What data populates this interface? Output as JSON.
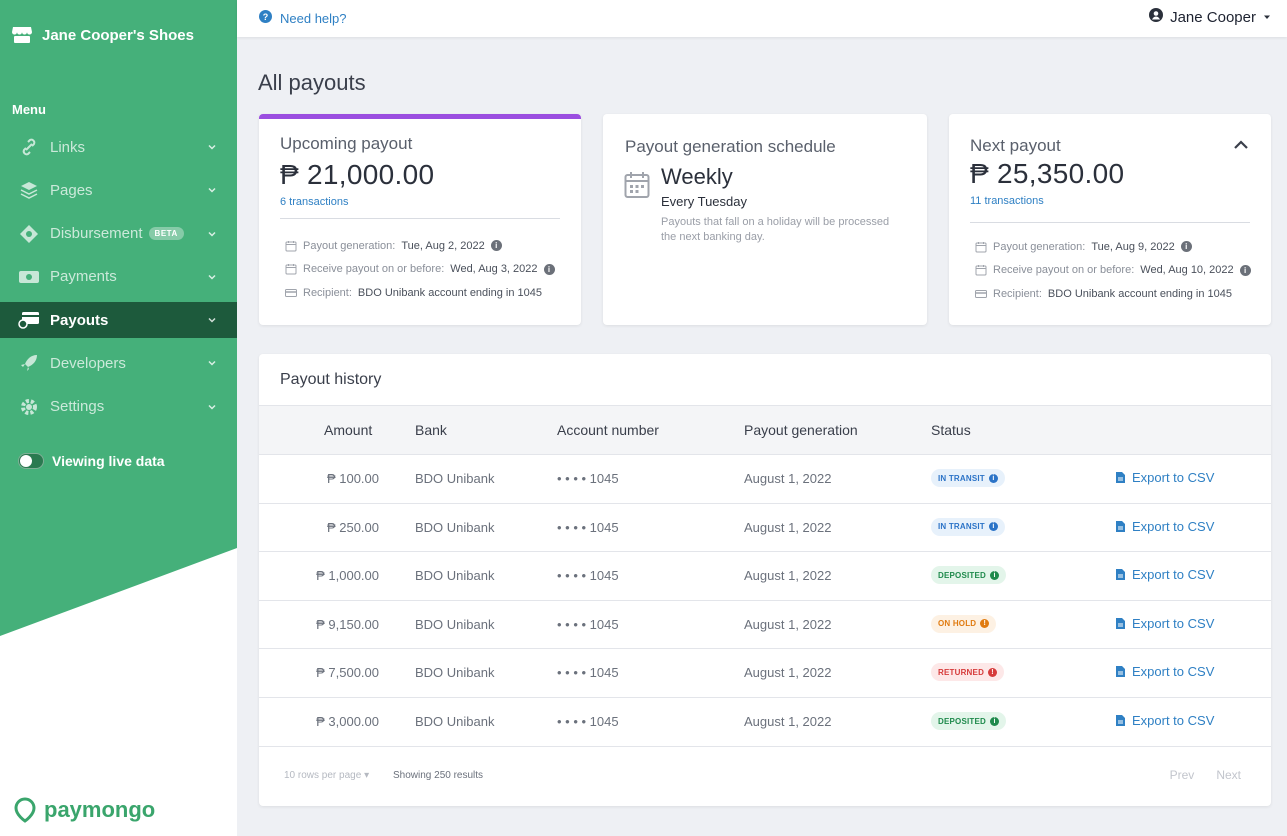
{
  "sidebar": {
    "brand": "Jane Cooper's Shoes",
    "menu_title": "Menu",
    "items": [
      {
        "label": "Links",
        "icon": "links-icon"
      },
      {
        "label": "Pages",
        "icon": "pages-icon"
      },
      {
        "label": "Disbursement",
        "icon": "disbursement-icon",
        "badge": "BETA"
      },
      {
        "label": "Payments",
        "icon": "payments-icon"
      },
      {
        "label": "Payouts",
        "icon": "payouts-icon",
        "active": true
      },
      {
        "label": "Developers",
        "icon": "developers-icon"
      },
      {
        "label": "Settings",
        "icon": "settings-icon"
      }
    ],
    "live_toggle_label": "Viewing live data",
    "logo_text": "paymongo",
    "colors": {
      "green": "#45b07a",
      "active": "#1d5a3c"
    }
  },
  "topbar": {
    "help_label": "Need help?",
    "user_name": "Jane Cooper"
  },
  "page_title": "All payouts",
  "upcoming": {
    "label": "Upcoming payout",
    "amount": "₱ 21,000.00",
    "transactions": "6 transactions",
    "gen_label": "Payout generation:",
    "gen_value": "Tue, Aug 2, 2022",
    "receive_label": "Receive payout on or before:",
    "receive_value": "Wed, Aug 3, 2022",
    "recipient_label": "Recipient:",
    "recipient_value": "BDO Unibank account ending in 1045"
  },
  "schedule": {
    "label": "Payout generation schedule",
    "frequency": "Weekly",
    "day": "Every Tuesday",
    "note_line1": "Payouts that fall on a holiday will be processed",
    "note_line2": "the next banking day."
  },
  "next": {
    "label": "Next payout",
    "amount": "₱ 25,350.00",
    "transactions": "11 transactions",
    "gen_label": "Payout generation:",
    "gen_value": "Tue, Aug 9, 2022",
    "receive_label": "Receive payout on or before:",
    "receive_value": "Wed, Aug 10, 2022",
    "recipient_label": "Recipient:",
    "recipient_value": "BDO Unibank account ending in 1045"
  },
  "history": {
    "title": "Payout history",
    "columns": [
      "Amount",
      "Bank",
      "Account number",
      "Payout generation",
      "Status"
    ],
    "rows": [
      {
        "amount": "₱ 100.00",
        "bank": "BDO Unibank",
        "account": "• • • • 1045",
        "date": "August 1, 2022",
        "status": "IN TRANSIT",
        "status_type": "transit",
        "action": "Export to CSV"
      },
      {
        "amount": "₱ 250.00",
        "bank": "BDO Unibank",
        "account": "• • • • 1045",
        "date": "August 1, 2022",
        "status": "IN TRANSIT",
        "status_type": "transit",
        "action": "Export to CSV"
      },
      {
        "amount": "₱ 1,000.00",
        "bank": "BDO Unibank",
        "account": "• • • • 1045",
        "date": "August 1, 2022",
        "status": "DEPOSITED",
        "status_type": "deposited",
        "action": "Export to CSV"
      },
      {
        "amount": "₱ 9,150.00",
        "bank": "BDO Unibank",
        "account": "• • • • 1045",
        "date": "August 1, 2022",
        "status": "ON HOLD",
        "status_type": "hold",
        "action": "Export to CSV"
      },
      {
        "amount": "₱ 7,500.00",
        "bank": "BDO Unibank",
        "account": "• • • • 1045",
        "date": "August 1, 2022",
        "status": "RETURNED",
        "status_type": "returned",
        "action": "Export to CSV"
      },
      {
        "amount": "₱ 3,000.00",
        "bank": "BDO Unibank",
        "account": "• • • • 1045",
        "date": "August 1, 2022",
        "status": "DEPOSITED",
        "status_type": "deposited",
        "action": "Export to CSV"
      }
    ],
    "rows_per_page": "10 rows per page",
    "showing": "Showing 250 results",
    "prev": "Prev",
    "next": "Next"
  }
}
